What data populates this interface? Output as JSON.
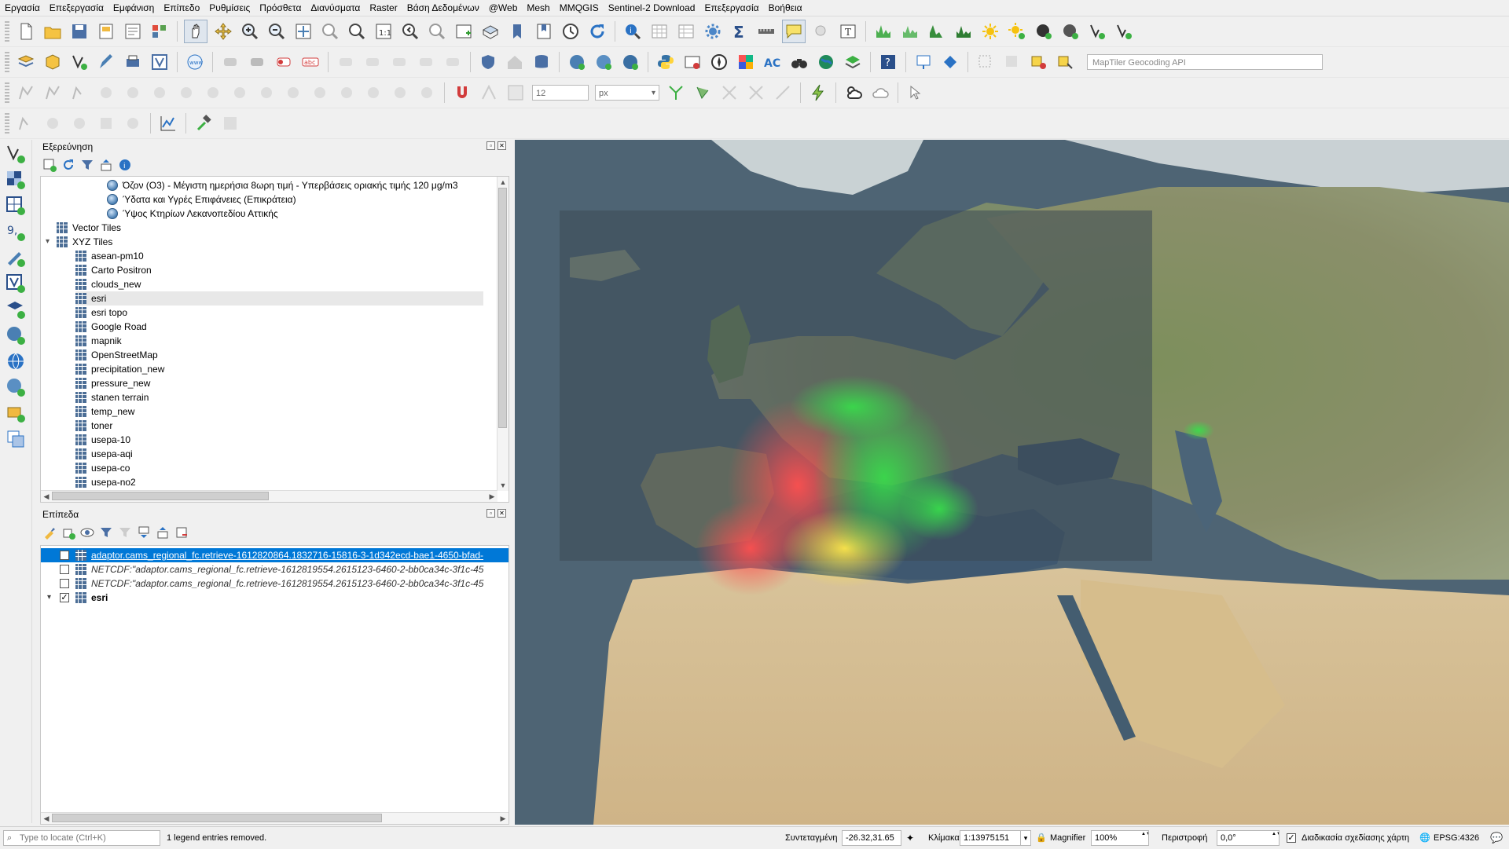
{
  "menu": [
    "Εργασία",
    "Επεξεργασία",
    "Εμφάνιση",
    "Επίπεδο",
    "Ρυθμίσεις",
    "Πρόσθετα",
    "Διανύσματα",
    "Raster",
    "Βάση Δεδομένων",
    "@Web",
    "Mesh",
    "MMQGIS",
    "Sentinel-2 Download",
    "Επεξεργασία",
    "Βοήθεια"
  ],
  "geocoder": {
    "placeholder": "MapTiler Geocoding API"
  },
  "digitize": {
    "size": "12",
    "unit": "px"
  },
  "browser": {
    "title": "Εξερεύνηση",
    "items": [
      {
        "label": "Όζον (Ο3) - Μέγιστη ημερήσια 8ωρη τιμή - Υπερβάσεις οριακής τιμής 120 μg/m3",
        "icon": "wms-globe-icon",
        "level": 3
      },
      {
        "label": "Ύδατα και Υγρές Επιφάνειες (Επικράτεια)",
        "icon": "wms-globe-icon",
        "level": 3
      },
      {
        "label": "Ύψος Κτηρίων Λεκανοπεδίου Αττικής",
        "icon": "wms-globe-icon",
        "level": 3
      },
      {
        "label": "Vector Tiles",
        "icon": "vector-tiles-icon",
        "level": 1
      },
      {
        "label": "XYZ Tiles",
        "icon": "xyz-tiles-icon",
        "level": 1,
        "expanded": true
      },
      {
        "label": "asean-pm10",
        "icon": "tile-icon",
        "level": 2
      },
      {
        "label": "Carto Positron",
        "icon": "tile-icon",
        "level": 2
      },
      {
        "label": "clouds_new",
        "icon": "tile-icon",
        "level": 2
      },
      {
        "label": "esri",
        "icon": "tile-icon",
        "level": 2,
        "highlighted": true
      },
      {
        "label": "esri topo",
        "icon": "tile-icon",
        "level": 2
      },
      {
        "label": "Google Road",
        "icon": "tile-icon",
        "level": 2
      },
      {
        "label": "mapnik",
        "icon": "tile-icon",
        "level": 2
      },
      {
        "label": "OpenStreetMap",
        "icon": "tile-icon",
        "level": 2
      },
      {
        "label": "precipitation_new",
        "icon": "tile-icon",
        "level": 2
      },
      {
        "label": "pressure_new",
        "icon": "tile-icon",
        "level": 2
      },
      {
        "label": "stanen terrain",
        "icon": "tile-icon",
        "level": 2
      },
      {
        "label": "temp_new",
        "icon": "tile-icon",
        "level": 2
      },
      {
        "label": "toner",
        "icon": "tile-icon",
        "level": 2
      },
      {
        "label": "usepa-10",
        "icon": "tile-icon",
        "level": 2
      },
      {
        "label": "usepa-aqi",
        "icon": "tile-icon",
        "level": 2
      },
      {
        "label": "usepa-co",
        "icon": "tile-icon",
        "level": 2
      },
      {
        "label": "usepa-no2",
        "icon": "tile-icon",
        "level": 2
      }
    ]
  },
  "layers": {
    "title": "Επίπεδα",
    "items": [
      {
        "label": "adaptor.cams_regional_fc.retrieve-1612820864.1832716-15816-3-1d342ecd-bae1-4650-bfad-",
        "checked": true,
        "selected": true
      },
      {
        "label": "NETCDF:\"adaptor.cams_regional_fc.retrieve-1612819554.2615123-6460-2-bb0ca34c-3f1c-45",
        "checked": false
      },
      {
        "label": "NETCDF:\"adaptor.cams_regional_fc.retrieve-1612819554.2615123-6460-2-bb0ca34c-3f1c-45",
        "checked": false
      },
      {
        "label": "esri",
        "checked": true,
        "group": true
      }
    ]
  },
  "status": {
    "locate_placeholder": "Type to locate (Ctrl+K)",
    "message": "1 legend entries removed.",
    "coord_label": "Συντεταγμένη",
    "coord_value": "-26.32,31.65",
    "scale_label": "Κλίμακα",
    "scale_value": "1:13975151",
    "magnifier_label": "Magnifier",
    "magnifier_value": "100%",
    "rotation_label": "Περιστροφή",
    "rotation_value": "0,0°",
    "render_label": "Διαδικασία σχεδίασης χάρτη",
    "crs": "EPSG:4326"
  }
}
